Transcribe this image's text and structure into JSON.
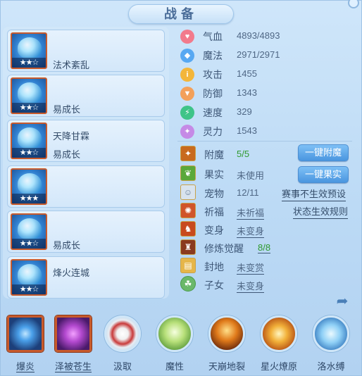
{
  "window": {
    "title": "战备"
  },
  "pets": [
    {
      "stars": "★★☆",
      "text": "法术紊乱"
    },
    {
      "stars": "★★☆",
      "text": "易成长"
    },
    {
      "stars": "★★☆",
      "text_top": "天降甘霖",
      "text": "易成长"
    },
    {
      "stars": "★★★",
      "text": ""
    },
    {
      "stars": "★★☆",
      "text": "易成长"
    },
    {
      "stars": "★★☆",
      "text_top": "烽火连城",
      "text": ""
    }
  ],
  "stats": [
    {
      "label": "气血",
      "value": "4893/4893",
      "icon": "heart-icon",
      "color": "#f27a8c",
      "glyph": "♥"
    },
    {
      "label": "魔法",
      "value": "2971/2971",
      "icon": "mana-icon",
      "color": "#57a8f2",
      "glyph": "◆"
    },
    {
      "label": "攻击",
      "value": "1455",
      "icon": "attack-icon",
      "color": "#f3b63a",
      "glyph": "i"
    },
    {
      "label": "防御",
      "value": "1343",
      "icon": "defense-icon",
      "color": "#f3a05a",
      "glyph": "▼"
    },
    {
      "label": "速度",
      "value": "329",
      "icon": "speed-icon",
      "color": "#3ec488",
      "glyph": "⚡"
    },
    {
      "label": "灵力",
      "value": "1543",
      "icon": "spirit-icon",
      "color": "#c58ae6",
      "glyph": "✦"
    }
  ],
  "info": {
    "enchant": {
      "label": "附魔",
      "value": "5/5"
    },
    "fruit": {
      "label": "果实",
      "value": "未使用"
    },
    "pet": {
      "label": "宠物",
      "value": "12/11"
    },
    "bless": {
      "label": "祈福",
      "value": "未祈福"
    },
    "transform": {
      "label": "变身",
      "value": "未变身"
    },
    "cultivate": {
      "label": "修炼觉醒",
      "value": "8/8"
    },
    "land": {
      "label": "封地",
      "value": "未变赏"
    },
    "children": {
      "label": "子女",
      "value": "未变身"
    }
  },
  "buttons": {
    "enchant": "一键附魔",
    "fruit": "一键果实",
    "event_preset": "赛事不生效预设",
    "status_rule": "状态生效规则"
  },
  "skills": [
    {
      "label": "爆炎",
      "icon": "explosion-skill-icon",
      "c1": "#bfe6ff",
      "c2": "#2a6fc8",
      "square": true,
      "underline": true
    },
    {
      "label": "泽被苍生",
      "icon": "blessing-skill-icon",
      "c1": "#f2a0ff",
      "c2": "#8a2aa8",
      "square": true,
      "underline": true
    },
    {
      "label": "汲取",
      "icon": "absorb-skill-icon",
      "c1": "#ffffff",
      "c2": "#c93a3a",
      "square": false,
      "underline": false
    },
    {
      "label": "魔性",
      "icon": "demonic-skill-icon",
      "c1": "#e6f7c0",
      "c2": "#6aa83a",
      "square": false,
      "underline": false
    },
    {
      "label": "天崩地裂",
      "icon": "earthquake-skill-icon",
      "c1": "#ffd27a",
      "c2": "#8a3a12",
      "square": false,
      "underline": false
    },
    {
      "label": "星火燎原",
      "icon": "starfire-skill-icon",
      "c1": "#fff2a0",
      "c2": "#d8701a",
      "square": false,
      "underline": false
    },
    {
      "label": "洛水缚",
      "icon": "water-bind-skill-icon",
      "c1": "#e0f7ff",
      "c2": "#3a8fd8",
      "square": false,
      "underline": false
    }
  ]
}
